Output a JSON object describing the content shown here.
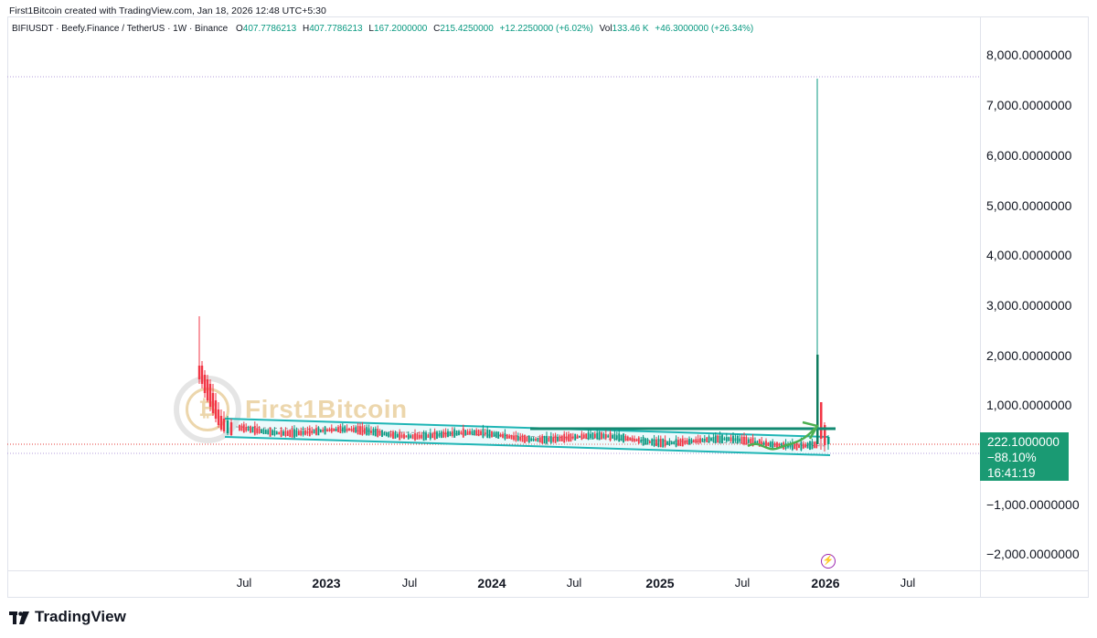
{
  "header": {
    "credit": "First1Bitcoin created with TradingView.com, Jan 18, 2026 12:48 UTC+5:30"
  },
  "legend": {
    "symbol": "BIFIUSDT · Beefy.Finance / TetherUS · 1W · Binance",
    "open_label": "O",
    "open": "407.7786213",
    "high_label": "H",
    "high": "407.7786213",
    "low_label": "L",
    "low": "167.2000000",
    "close_label": "C",
    "close": "215.4250000",
    "change": "+12.2250000 (+6.02%)",
    "vol_label": "Vol",
    "vol": "133.46 K",
    "vol_change": "+46.3000000 (+26.34%)"
  },
  "price_axis": {
    "labels": [
      "8,000.0000000",
      "7,000.0000000",
      "6,000.0000000",
      "5,000.0000000",
      "4,000.0000000",
      "3,000.0000000",
      "2,000.0000000",
      "1,000.0000000",
      "−1,000.0000000",
      "−2,000.0000000"
    ]
  },
  "time_axis": {
    "labels": [
      {
        "text": "Jul",
        "year": false
      },
      {
        "text": "2023",
        "year": true
      },
      {
        "text": "Jul",
        "year": false
      },
      {
        "text": "2024",
        "year": true
      },
      {
        "text": "Jul",
        "year": false
      },
      {
        "text": "2025",
        "year": true
      },
      {
        "text": "Jul",
        "year": false
      },
      {
        "text": "2026",
        "year": true
      },
      {
        "text": "Jul",
        "year": false
      }
    ]
  },
  "price_tag": {
    "price": "222.1000000",
    "change_pct": "−88.10%",
    "countdown": "16:41:19"
  },
  "watermark": {
    "text": "First1Bitcoin"
  },
  "footer": {
    "brand": "TradingView"
  },
  "colors": {
    "up": "#089981",
    "down": "#f23645",
    "channel": "#1fb5b5",
    "tag": "#1a9a73",
    "arrow": "#4caf50"
  },
  "icons": {
    "flash": "flash-icon",
    "brand": "tradingview-logo-icon"
  }
}
